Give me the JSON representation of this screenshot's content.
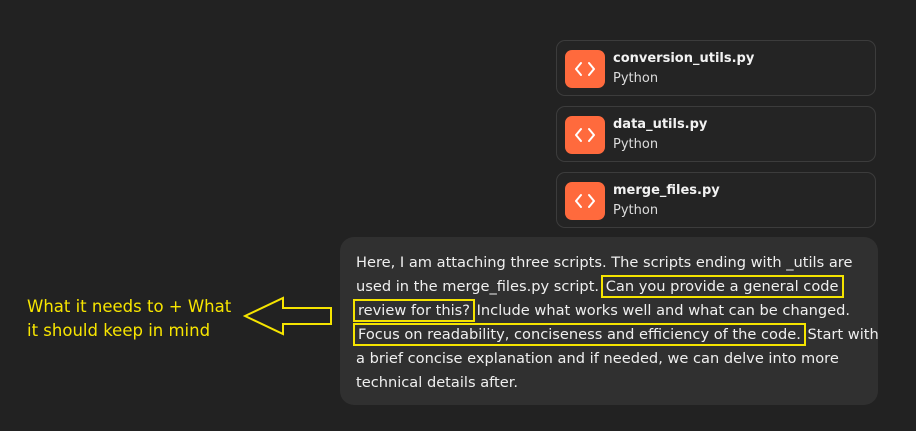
{
  "files": [
    {
      "name": "conversion_utils.py",
      "type": "Python"
    },
    {
      "name": "data_utils.py",
      "type": "Python"
    },
    {
      "name": "merge_files.py",
      "type": "Python"
    }
  ],
  "message": {
    "line1": "Here, I am attaching three scripts. The scripts ending with _utils are",
    "line2_pre": "used in the merge_files.py script.",
    "line2_hl": "Can you provide a general code",
    "line3_hl": "review for this?",
    "line3_post": "Include what works well and what can be changed.",
    "line4_hl": "Focus on readability, conciseness and efficiency of the code.",
    "line4_post": "Start with",
    "line5": "a brief concise explanation and if needed, we can delve into more",
    "line6": "technical details after."
  },
  "annotation": {
    "line1": "What it needs to + What",
    "line2": "it should keep in mind"
  },
  "colors": {
    "background": "#222222",
    "file_icon": "#ff6a3d",
    "highlight": "#f5e400",
    "bubble": "#303030"
  },
  "icons": {
    "file": "code-brackets-icon",
    "pointer": "left-arrow-icon"
  }
}
